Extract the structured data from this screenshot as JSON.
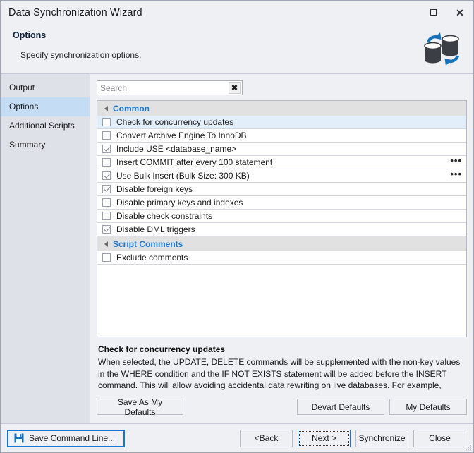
{
  "window": {
    "title": "Data Synchronization Wizard",
    "maximize_icon": "maximize-icon",
    "close_icon": "close-icon"
  },
  "header": {
    "title": "Options",
    "subtitle": "Specify synchronization options.",
    "icon": "database-sync-icon"
  },
  "sidebar": {
    "items": [
      {
        "label": "Output",
        "active": false
      },
      {
        "label": "Options",
        "active": true
      },
      {
        "label": "Additional Scripts",
        "active": false
      },
      {
        "label": "Summary",
        "active": false
      }
    ]
  },
  "search": {
    "value": "",
    "placeholder": "Search",
    "clear_label": "✖",
    "clear_icon": "clear-search-icon"
  },
  "options": {
    "groups": [
      {
        "label": "Common",
        "expanded": true,
        "rows": [
          {
            "label": "Check for concurrency updates",
            "checked": false,
            "selected": true,
            "more": false
          },
          {
            "label": "Convert Archive Engine To InnoDB",
            "checked": false,
            "selected": false,
            "more": false
          },
          {
            "label": "Include USE <database_name>",
            "checked": true,
            "selected": false,
            "more": false
          },
          {
            "label": "Insert COMMIT after every 100 statement",
            "checked": false,
            "selected": false,
            "more": true
          },
          {
            "label": "Use Bulk Insert (Bulk Size: 300 KB)",
            "checked": true,
            "selected": false,
            "more": true
          },
          {
            "label": "Disable foreign keys",
            "checked": true,
            "selected": false,
            "more": false
          },
          {
            "label": "Disable primary keys and indexes",
            "checked": false,
            "selected": false,
            "more": false
          },
          {
            "label": "Disable check constraints",
            "checked": false,
            "selected": false,
            "more": false
          },
          {
            "label": "Disable DML triggers",
            "checked": true,
            "selected": false,
            "more": false
          }
        ]
      },
      {
        "label": "Script Comments",
        "expanded": true,
        "rows": [
          {
            "label": "Exclude comments",
            "checked": false,
            "selected": false,
            "more": false
          }
        ]
      }
    ],
    "more_label": "•••"
  },
  "description": {
    "title": "Check for concurrency updates",
    "text": "When selected, the UPDATE, DELETE commands will be supplemented with the non-key values in the WHERE condition and the IF NOT EXISTS statement will be added before the INSERT command. This will allow avoiding accidental data rewriting on live databases. For example, UPDATE PassTable SET"
  },
  "defaults_bar": {
    "save_as_my_defaults": "Save As My Defaults",
    "devart_defaults": "Devart Defaults",
    "my_defaults": "My Defaults"
  },
  "footer": {
    "save_command_line": "Save Command Line...",
    "save_icon": "floppy-disk-icon",
    "back": "< Back",
    "next": "Next >",
    "synchronize": "Synchronize",
    "close": "Close"
  },
  "colors": {
    "accent": "#1c7ad4",
    "focus_border": "#1479d6",
    "selection": "#c5dcf5",
    "row_selected": "#e3eefb",
    "window_bg": "#eef0f4",
    "sidebar_bg": "#dfe1e8",
    "group_header_bg": "#e1e1e1"
  }
}
